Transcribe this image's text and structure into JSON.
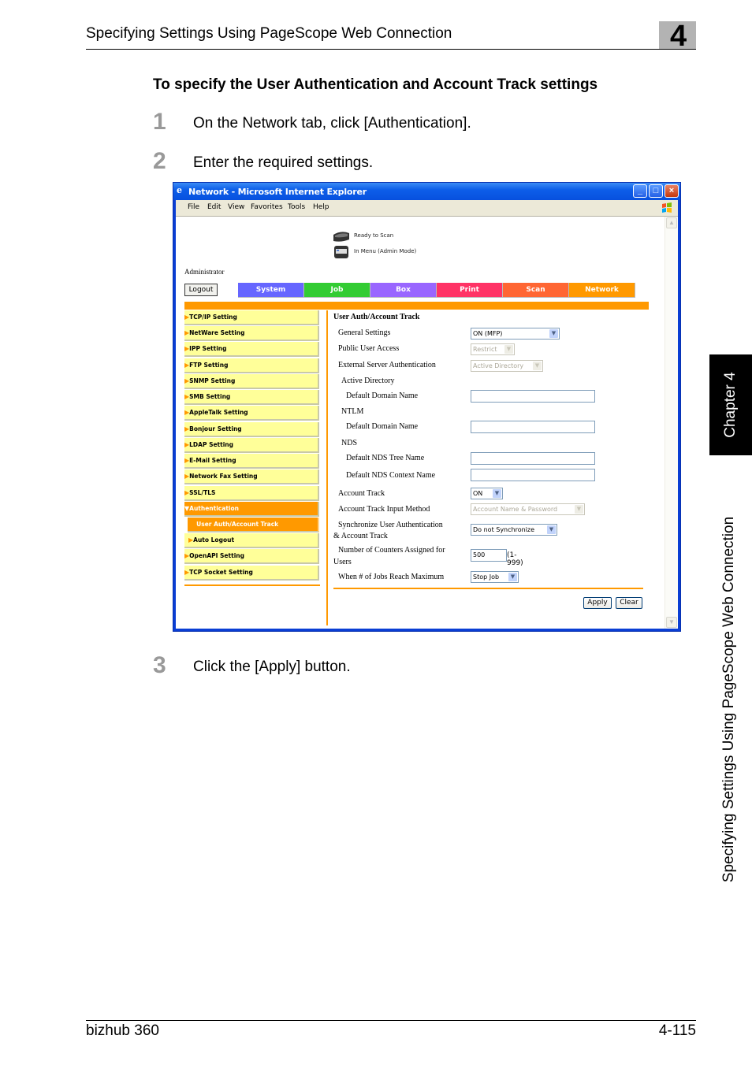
{
  "page": {
    "header_title": "Specifying Settings Using PageScope Web Connection",
    "chapter_number": "4",
    "side_tab_chapter": "Chapter 4",
    "side_tab_section": "Specifying Settings Using PageScope Web Connection",
    "heading": "To specify the User Authentication and Account Track settings",
    "steps": [
      {
        "num": "1",
        "text": "On the Network tab, click [Authentication]."
      },
      {
        "num": "2",
        "text": "Enter the required settings."
      },
      {
        "num": "3",
        "text": "Click the [Apply] button."
      }
    ],
    "footer_left": "bizhub 360",
    "footer_right": "4-115"
  },
  "browser": {
    "title": "Network - Microsoft Internet Explorer",
    "menu": [
      "File",
      "Edit",
      "View",
      "Favorites",
      "Tools",
      "Help"
    ],
    "status": [
      {
        "icon": "scanner-icon",
        "text": "Ready to Scan"
      },
      {
        "icon": "printer-icon",
        "text": "In Menu (Admin Mode)"
      }
    ],
    "user_label": "Administrator",
    "logout_label": "Logout",
    "tabs": [
      {
        "label": "System",
        "color": "#6666ff"
      },
      {
        "label": "Job",
        "color": "#33cc33"
      },
      {
        "label": "Box",
        "color": "#9966ff"
      },
      {
        "label": "Print",
        "color": "#ff3366"
      },
      {
        "label": "Scan",
        "color": "#ff6633"
      },
      {
        "label": "Network",
        "color": "#ff9900"
      }
    ],
    "active_tab": "Network",
    "sidebar": [
      {
        "label": "TCP/IP Setting"
      },
      {
        "label": "NetWare Setting"
      },
      {
        "label": "IPP Setting"
      },
      {
        "label": "FTP Setting"
      },
      {
        "label": "SNMP Setting"
      },
      {
        "label": "SMB Setting"
      },
      {
        "label": "AppleTalk Setting"
      },
      {
        "label": "Bonjour Setting"
      },
      {
        "label": "LDAP Setting"
      },
      {
        "label": "E-Mail Setting"
      },
      {
        "label": "Network Fax Setting"
      },
      {
        "label": "SSL/TLS"
      },
      {
        "label": "Authentication"
      },
      {
        "label": "User Auth/Account Track"
      },
      {
        "label": "Auto Logout"
      },
      {
        "label": "OpenAPI Setting"
      },
      {
        "label": "TCP Socket Setting"
      }
    ],
    "form": {
      "title": "User Auth/Account Track",
      "general_settings": {
        "label": "General Settings",
        "value": "ON (MFP)"
      },
      "public_user_access": {
        "label": "Public User Access",
        "value": "Restrict"
      },
      "external_server_auth": {
        "label": "External Server Authentication",
        "value": "Active Directory"
      },
      "active_directory": "Active Directory",
      "ad_domain": {
        "label": "Default Domain Name",
        "value": ""
      },
      "ntlm": "NTLM",
      "ntlm_domain": {
        "label": "Default Domain Name",
        "value": ""
      },
      "nds": "NDS",
      "nds_tree": {
        "label": "Default NDS Tree Name",
        "value": ""
      },
      "nds_context": {
        "label": "Default NDS Context Name",
        "value": ""
      },
      "account_track": {
        "label": "Account Track",
        "value": "ON"
      },
      "account_track_input": {
        "label": "Account Track Input Method",
        "value": "Account Name & Password"
      },
      "sync": {
        "label_line1": "Synchronize User Authentication",
        "label_line2": "& Account Track",
        "value": "Do not Synchronize"
      },
      "counters": {
        "label_line1": "Number of Counters Assigned for",
        "label_line2": "Users",
        "value": "500",
        "range": "(1-999)"
      },
      "jobs_max": {
        "label": "When # of Jobs Reach Maximum",
        "value": "Stop Job"
      },
      "apply_label": "Apply",
      "clear_label": "Clear"
    }
  }
}
